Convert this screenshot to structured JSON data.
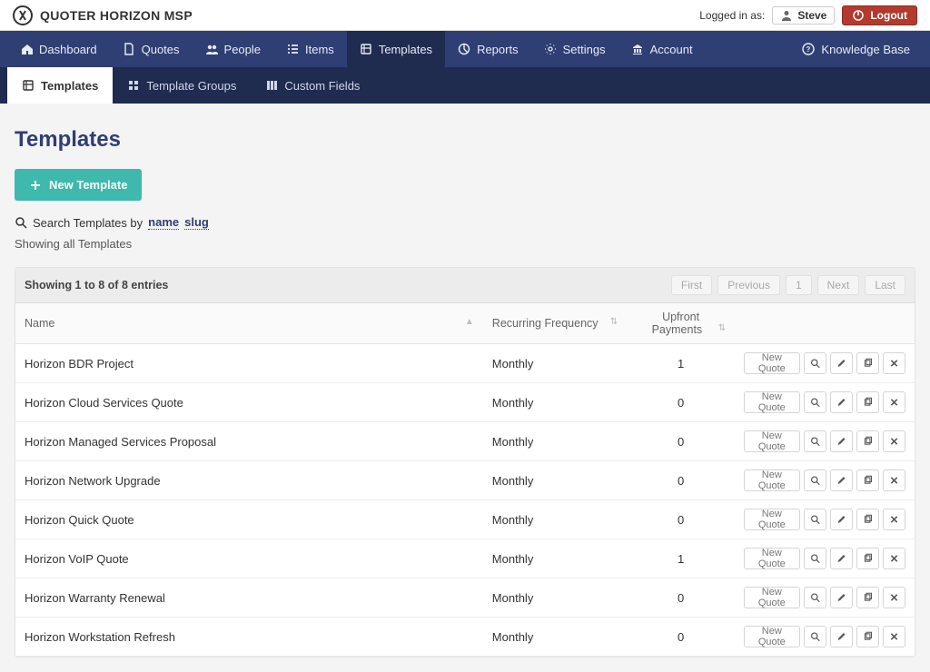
{
  "brand": {
    "name": "QUOTER HORIZON MSP"
  },
  "topbar": {
    "logged_in_as_label": "Logged in as:",
    "user_name": "Steve",
    "logout_label": "Logout"
  },
  "nav": {
    "items": [
      {
        "label": "Dashboard",
        "icon": "home-icon"
      },
      {
        "label": "Quotes",
        "icon": "doc-icon"
      },
      {
        "label": "People",
        "icon": "people-icon"
      },
      {
        "label": "Items",
        "icon": "list-icon"
      },
      {
        "label": "Templates",
        "icon": "template-icon"
      },
      {
        "label": "Reports",
        "icon": "pie-icon"
      },
      {
        "label": "Settings",
        "icon": "gears-icon"
      },
      {
        "label": "Account",
        "icon": "bank-icon"
      }
    ],
    "kb_label": "Knowledge Base"
  },
  "subnav": {
    "items": [
      {
        "label": "Templates",
        "icon": "template-icon"
      },
      {
        "label": "Template Groups",
        "icon": "grid-icon"
      },
      {
        "label": "Custom Fields",
        "icon": "columns-icon"
      }
    ]
  },
  "page": {
    "title": "Templates",
    "new_template_label": "New Template",
    "search_prefix": "Search Templates by",
    "search_link_name": "name",
    "search_link_slug": "slug",
    "showing_all": "Showing all Templates"
  },
  "table": {
    "entries_text": "Showing 1 to 8 of 8 entries",
    "pager": {
      "first": "First",
      "previous": "Previous",
      "page": "1",
      "next": "Next",
      "last": "Last"
    },
    "columns": {
      "name": "Name",
      "freq": "Recurring Frequency",
      "upfront": "Upfront Payments"
    },
    "new_quote_label": "New Quote",
    "rows": [
      {
        "name": "Horizon BDR Project",
        "freq": "Monthly",
        "upfront": "1"
      },
      {
        "name": "Horizon Cloud Services Quote",
        "freq": "Monthly",
        "upfront": "0"
      },
      {
        "name": "Horizon Managed Services Proposal",
        "freq": "Monthly",
        "upfront": "0"
      },
      {
        "name": "Horizon Network Upgrade",
        "freq": "Monthly",
        "upfront": "0"
      },
      {
        "name": "Horizon Quick Quote",
        "freq": "Monthly",
        "upfront": "0"
      },
      {
        "name": "Horizon VoIP Quote",
        "freq": "Monthly",
        "upfront": "1"
      },
      {
        "name": "Horizon Warranty Renewal",
        "freq": "Monthly",
        "upfront": "0"
      },
      {
        "name": "Horizon Workstation Refresh",
        "freq": "Monthly",
        "upfront": "0"
      }
    ]
  }
}
